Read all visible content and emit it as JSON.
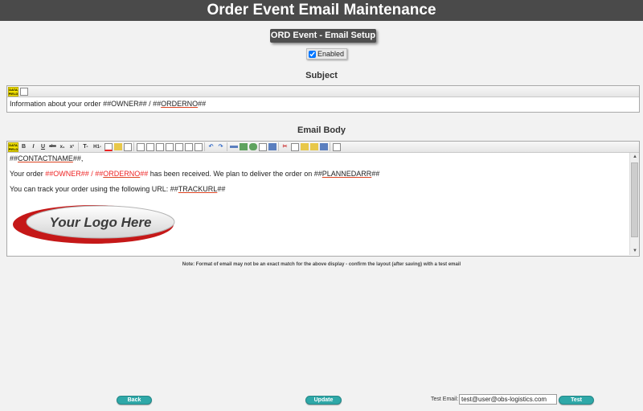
{
  "header": {
    "title": "Order Event Email Maintenance"
  },
  "setup": {
    "title": "ORD Event - Email Setup",
    "enabled_label": "Enabled",
    "enabled_checked": true
  },
  "subject": {
    "label": "Subject",
    "toolbar": {
      "datafield_top": "DATA",
      "datafield_bottom": "FIELD"
    },
    "text": {
      "prefix": "Information about your order ##",
      "owner": "OWNER",
      "mid": "## / ##",
      "orderno": "ORDERNO",
      "suffix": "##"
    }
  },
  "email_body": {
    "label": "Email Body",
    "toolbar": {
      "datafield_top": "DATA",
      "datafield_bottom": "FIELD",
      "bold": "B",
      "italic": "I",
      "underline": "U",
      "strike": "abc",
      "subscript": "x₁",
      "superscript": "x¹",
      "font_size": "T-",
      "heading": "H1-"
    },
    "line1": {
      "prefix": "##",
      "field": "CONTACTNAME",
      "suffix": "##,"
    },
    "line2": {
      "prefix": "Your order ",
      "owner_pre": "##",
      "owner": "OWNER",
      "owner_mid": "## / ##",
      "orderno": "ORDERNO",
      "orderno_post": "##",
      "middle": " has been received. We plan to deliver the order on ##",
      "planned": "PLANNEDARR",
      "suffix": "##"
    },
    "line3": {
      "prefix": "You can track your order using the following URL: ##",
      "field": "TRACKURL",
      "suffix": "##"
    },
    "logo_text": "Your Logo Here"
  },
  "note": "Note: Format of email may not be an exact match for the above display - confirm the layout (after saving) with a test email",
  "buttons": {
    "back": "Back",
    "update": "Update",
    "test": "Test"
  },
  "test_email": {
    "label": "Test Email:",
    "value": "test@user@obs-logistics.com"
  },
  "colors": {
    "header_bg": "#4a4a4a",
    "button_teal": "#2fa8a8",
    "field_red": "#e22222",
    "datafield_yellow": "#f4e300"
  }
}
